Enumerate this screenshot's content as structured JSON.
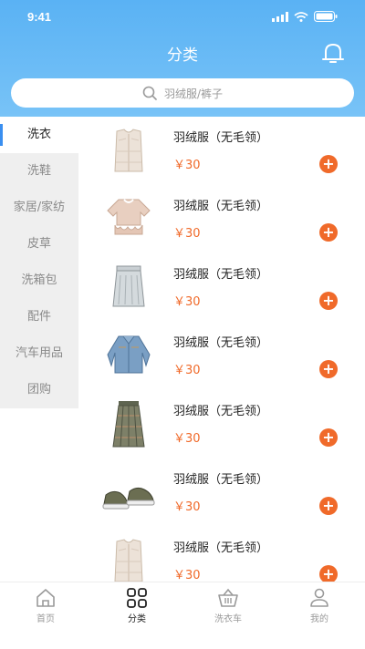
{
  "status_bar": {
    "time": "9:41"
  },
  "header": {
    "title": "分类",
    "bell_icon": "bell-icon"
  },
  "search": {
    "placeholder": "羽绒服/裤子"
  },
  "categories": [
    {
      "label": "洗衣",
      "active": true
    },
    {
      "label": "洗鞋"
    },
    {
      "label": "家居/家纺"
    },
    {
      "label": "皮草"
    },
    {
      "label": "洗箱包"
    },
    {
      "label": "配件"
    },
    {
      "label": "汽车用品"
    },
    {
      "label": "团购"
    }
  ],
  "products": [
    {
      "name": "羽绒服（无毛领）",
      "price": "￥30",
      "image": "vest"
    },
    {
      "name": "羽绒服（无毛领）",
      "price": "￥30",
      "image": "blouse"
    },
    {
      "name": "羽绒服（无毛领）",
      "price": "￥30",
      "image": "skirt"
    },
    {
      "name": "羽绒服（无毛领）",
      "price": "￥30",
      "image": "denim-jacket"
    },
    {
      "name": "羽绒服（无毛领）",
      "price": "￥30",
      "image": "plaid-skirt"
    },
    {
      "name": "羽绒服（无毛领）",
      "price": "￥30",
      "image": "sneakers"
    },
    {
      "name": "羽绒服（无毛领）",
      "price": "￥30",
      "image": "vest"
    }
  ],
  "tabbar": [
    {
      "label": "首页",
      "icon": "home-icon"
    },
    {
      "label": "分类",
      "icon": "category-icon",
      "active": true
    },
    {
      "label": "洗衣车",
      "icon": "basket-icon"
    },
    {
      "label": "我的",
      "icon": "user-icon"
    }
  ],
  "colors": {
    "header": "#5AB2F4",
    "price": "#f06a2a",
    "active_indicator": "#3a8ff0"
  }
}
